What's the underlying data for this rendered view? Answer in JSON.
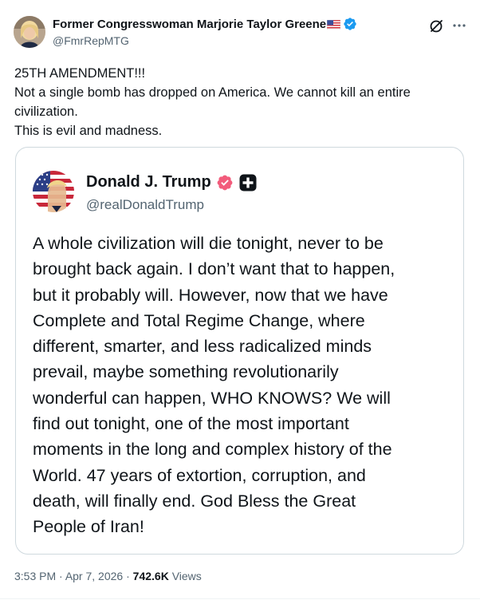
{
  "author": {
    "name": "Former Congresswoman Marjorie Taylor Greene",
    "handle": "@FmrRepMTG"
  },
  "tweet": {
    "lines": [
      "25TH AMENDMENT!!!",
      "Not a single bomb has dropped on America. We cannot kill an entire",
      "civilization.",
      "This is evil and madness."
    ]
  },
  "quoted_post": {
    "name": "Donald J. Trump",
    "handle": "@realDonaldTrump",
    "lines": [
      "A whole civilization will die tonight, never to be",
      "brought back again. I don’t want that to happen,",
      "but it probably will. However, now that we have",
      "Complete and Total Regime Change, where",
      "different, smarter, and less radicalized minds",
      "prevail, maybe something revolutionarily",
      "wonderful can happen, WHO KNOWS? We will",
      "find out tonight, one of the most important",
      "moments in the long and complex history of the",
      "World. 47 years of extortion, corruption, and",
      "death, will finally end. God Bless the Great",
      "People of Iran!"
    ]
  },
  "meta": {
    "time": "3:53 PM",
    "separator": " · ",
    "date": "Apr 7, 2026",
    "views_count": "742.6K",
    "views_label": " Views"
  },
  "icons": {
    "verified": "verified-badge-icon",
    "flag": "us-flag-icon",
    "grok": "grok-icon",
    "more": "more-icon",
    "quote_badge": "pink-verified-badge-icon",
    "plus": "plus-icon"
  },
  "colors": {
    "verified_blue": "#1d9bf0",
    "quote_badge_pink": "#f25b7b",
    "text_primary": "#0f1419",
    "text_secondary": "#536471",
    "border": "#cfd9de"
  }
}
